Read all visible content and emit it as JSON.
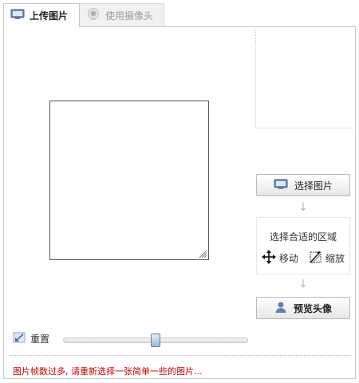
{
  "tabs": [
    {
      "label": "上传图片",
      "icon": "monitor-icon",
      "active": true
    },
    {
      "label": "使用摄像头",
      "icon": "webcam-icon",
      "active": false
    }
  ],
  "buttons": {
    "select_image": "选择图片",
    "preview_avatar": "预览头像"
  },
  "instructions": {
    "title": "选择合适的区域",
    "move": "移动",
    "zoom": "缩放"
  },
  "controls": {
    "reset_label": "重置",
    "slider_value": 0.5
  },
  "error_message": "图片帧数过多, 请重新选择一张简单一些的图片...",
  "colors": {
    "error": "#c00000",
    "border": "#c9c9c9",
    "slider_thumb": "#9fb8d7"
  }
}
